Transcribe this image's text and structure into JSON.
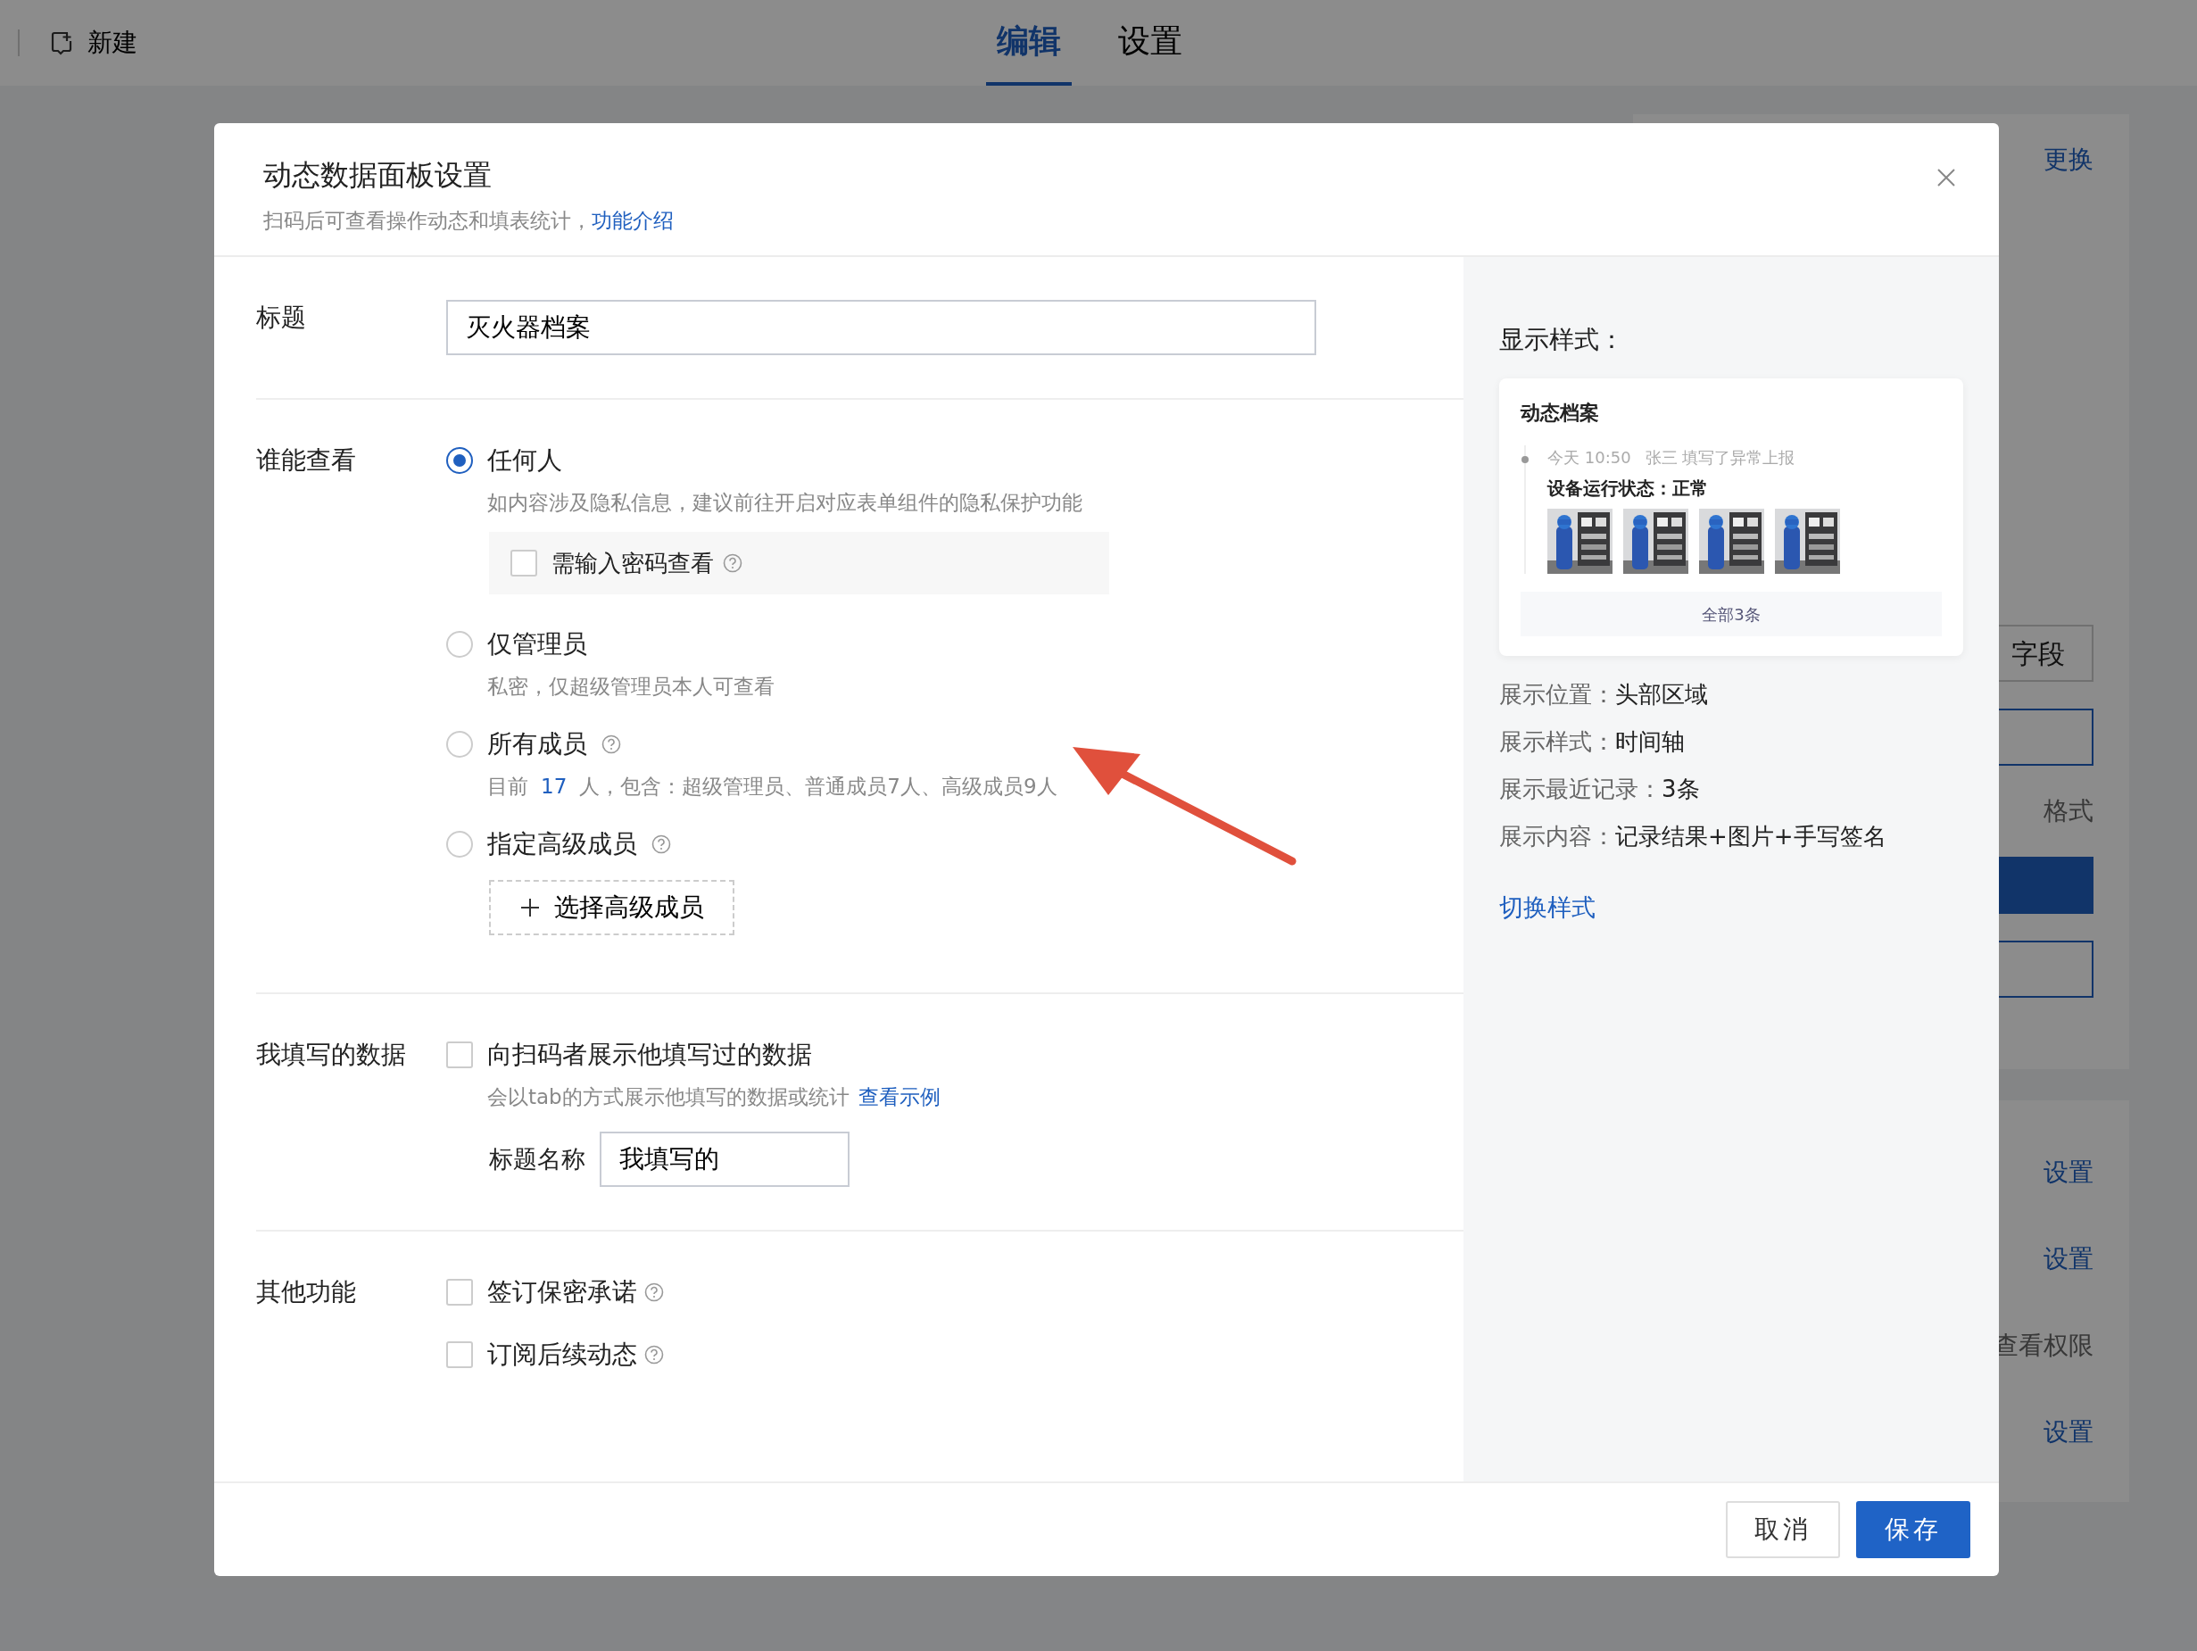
{
  "topbar": {
    "new_button": "新建",
    "tabs": [
      {
        "label": "编辑",
        "selected": true
      },
      {
        "label": "设置",
        "selected": false
      }
    ]
  },
  "background_panel": {
    "items": [
      {
        "kind": "link",
        "text": "更换"
      },
      {
        "kind": "box",
        "text": "字段"
      },
      {
        "kind": "input"
      },
      {
        "kind": "text",
        "text": "格式"
      },
      {
        "kind": "primary"
      },
      {
        "kind": "input"
      },
      {
        "kind": "gap"
      },
      {
        "kind": "link",
        "text": "设置"
      },
      {
        "kind": "link",
        "text": "设置"
      },
      {
        "kind": "text",
        "text": "查看权限"
      },
      {
        "kind": "link",
        "text": "设置"
      }
    ]
  },
  "dialog": {
    "title": "动态数据面板设置",
    "subtitle": "扫码后可查看操作动态和填表统计，",
    "subtitle_link": "功能介绍",
    "title_field": {
      "label": "标题",
      "value": "灭火器档案"
    },
    "visibility": {
      "label": "谁能查看",
      "options": [
        {
          "label": "任何人",
          "selected": true,
          "help": false,
          "hint": "如内容涉及隐私信息，建议前往开启对应表单组件的隐私保护功能",
          "password": {
            "label": "需输入密码查看",
            "checked": false
          }
        },
        {
          "label": "仅管理员",
          "selected": false,
          "help": false,
          "hint": "私密，仅超级管理员本人可查看"
        },
        {
          "label": "所有成员",
          "selected": false,
          "help": true,
          "hint_before": "目前",
          "hint_count": "17",
          "hint_after": "人，包含：超级管理员、普通成员7人、高级成员9人"
        },
        {
          "label": "指定高级成员",
          "selected": false,
          "help": true,
          "add_button": "选择高级成员"
        }
      ]
    },
    "my_data": {
      "label": "我填写的数据",
      "checkbox": {
        "label": "向扫码者展示他填写过的数据",
        "checked": false
      },
      "hint": "会以tab的方式展示他填写的数据或统计",
      "hint_link": "查看示例",
      "name_field": {
        "label": "标题名称",
        "value": "我填写的"
      }
    },
    "other": {
      "label": "其他功能",
      "options": [
        {
          "label": "签订保密承诺",
          "checked": false
        },
        {
          "label": "订阅后续动态",
          "checked": false
        }
      ]
    },
    "preview": {
      "heading": "显示样式：",
      "card": {
        "title": "动态档案",
        "time": "今天 10:50",
        "meta": "张三 填写了异常上报",
        "entry": "设备运行状态：正常",
        "more": "全部3条"
      },
      "details": [
        {
          "label": "展示位置：",
          "value": "头部区域"
        },
        {
          "label": "展示样式：",
          "value": "时间轴"
        },
        {
          "label": "展示最近记录：",
          "value": "3条"
        },
        {
          "label": "展示内容：",
          "value": "记录结果+图片+手写签名"
        }
      ],
      "switch_link": "切换样式"
    },
    "buttons": [
      {
        "label": "取消",
        "kind": "secondary"
      },
      {
        "label": "保存",
        "kind": "primary"
      }
    ]
  }
}
